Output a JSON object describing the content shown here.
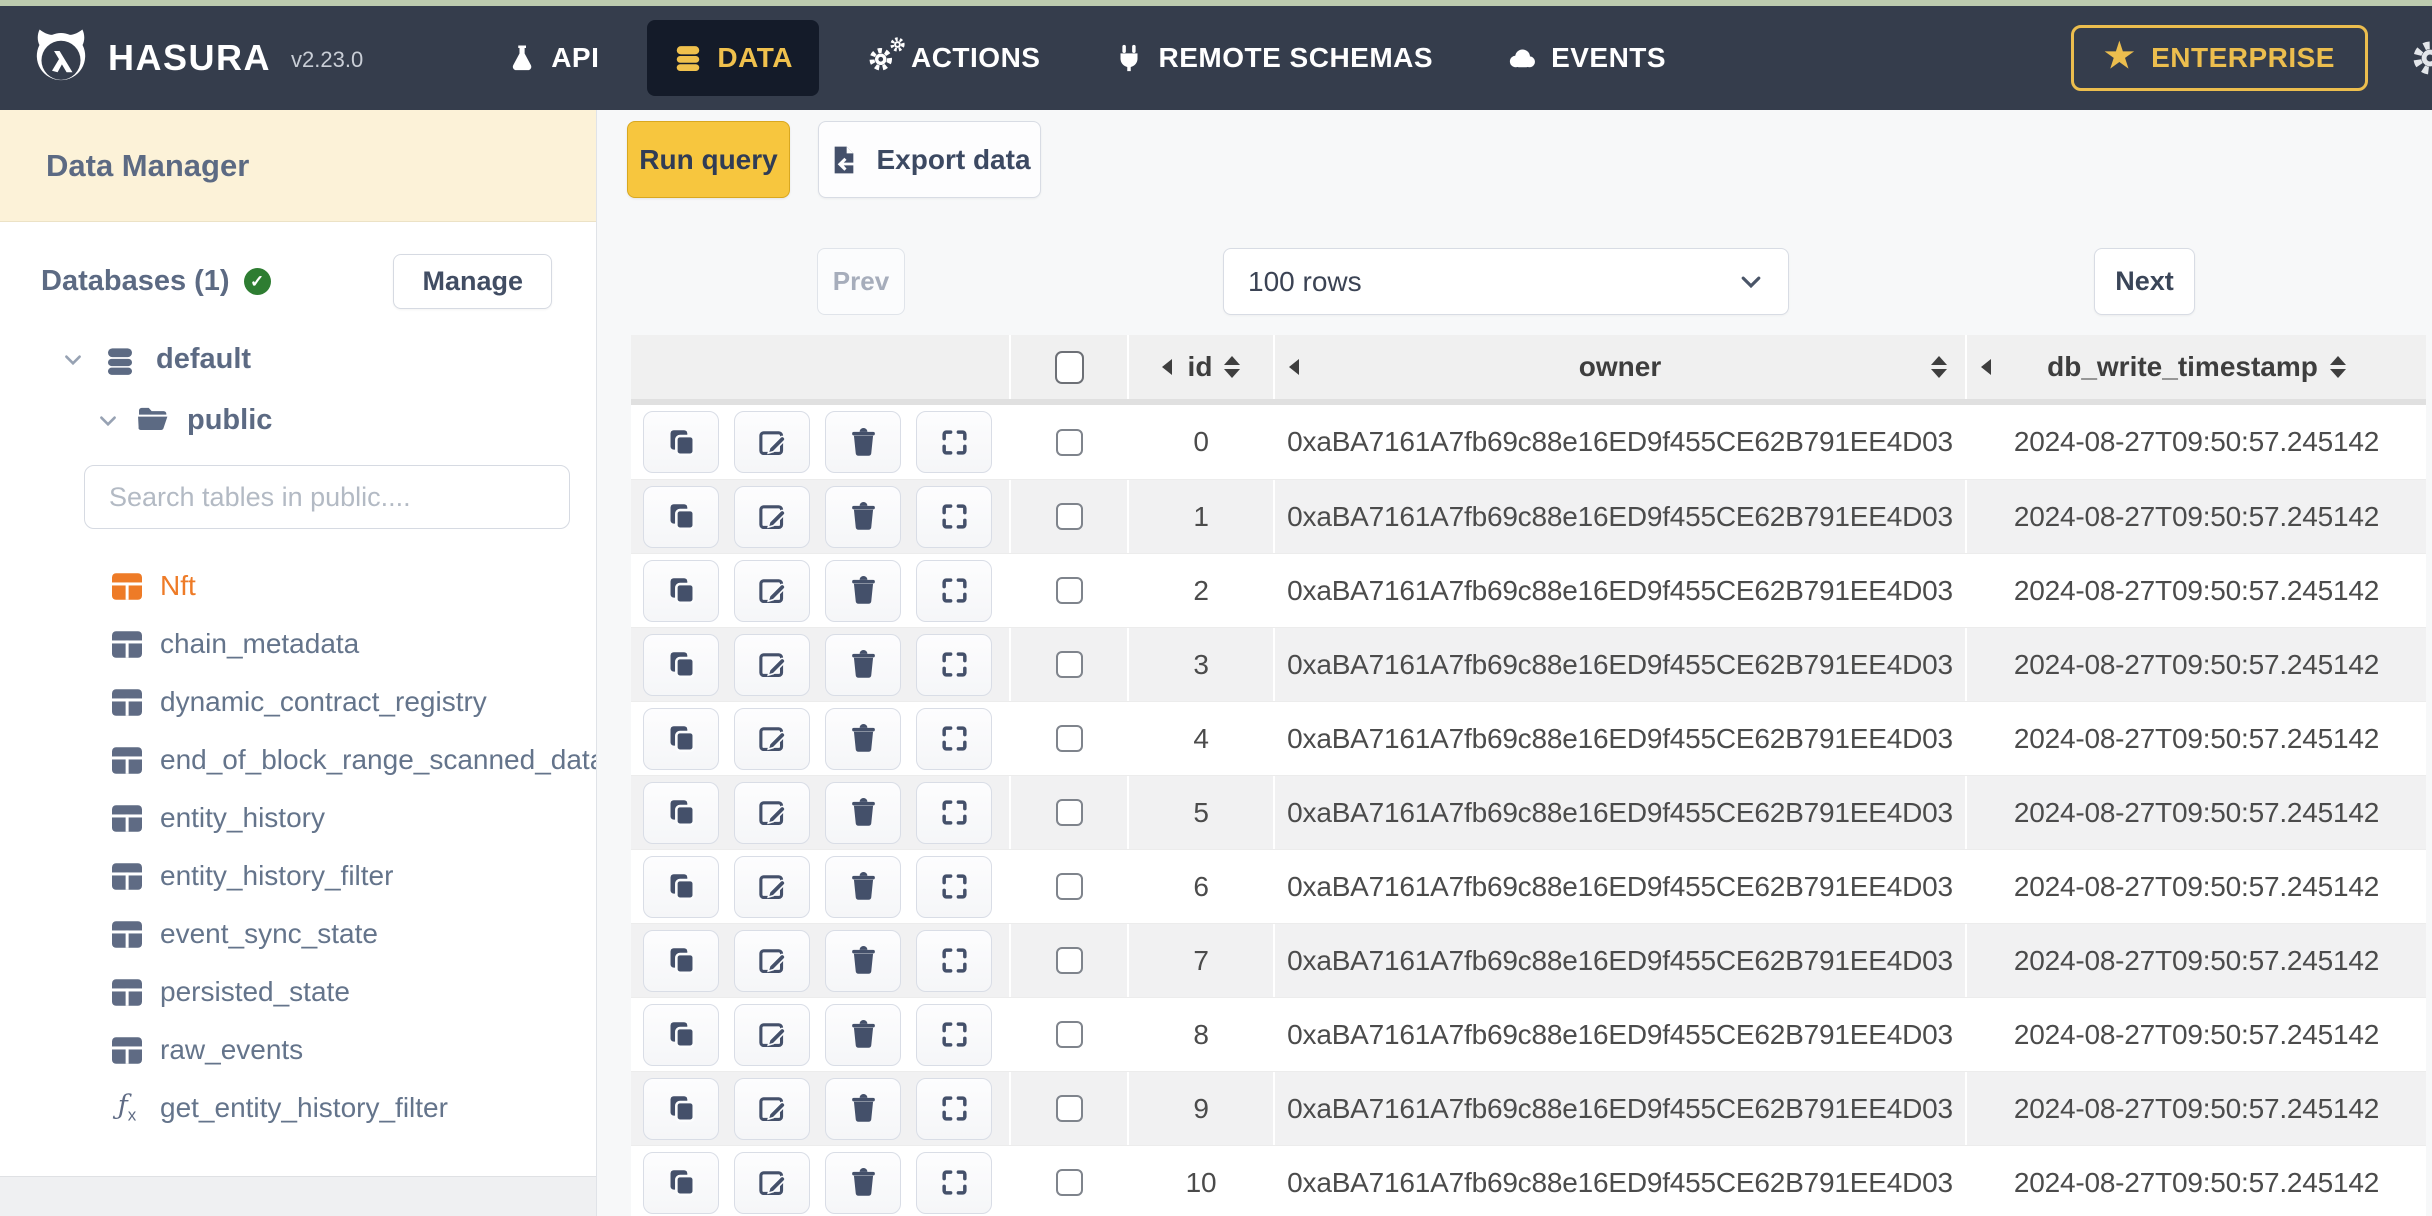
{
  "nav": {
    "brand": "HASURA",
    "version": "v2.23.0",
    "items": [
      {
        "label": "API",
        "icon": "flask-icon"
      },
      {
        "label": "DATA",
        "icon": "database-icon",
        "active": true
      },
      {
        "label": "ACTIONS",
        "icon": "gears-icon"
      },
      {
        "label": "REMOTE SCHEMAS",
        "icon": "plug-icon"
      },
      {
        "label": "EVENTS",
        "icon": "cloud-icon"
      }
    ],
    "enterprise_label": "ENTERPRISE",
    "star_glyph": "★"
  },
  "sidebar": {
    "title": "Data Manager",
    "databases_label": "Databases (1)",
    "check_glyph": "✓",
    "manage_button": "Manage",
    "connection": "default",
    "schema": "public",
    "search_placeholder": "Search tables in public....",
    "tables": [
      {
        "name": "Nft",
        "icon": "table-icon",
        "selected": true
      },
      {
        "name": "chain_metadata",
        "icon": "table-icon"
      },
      {
        "name": "dynamic_contract_registry",
        "icon": "table-icon"
      },
      {
        "name": "end_of_block_range_scanned_data",
        "icon": "table-icon"
      },
      {
        "name": "entity_history",
        "icon": "table-icon"
      },
      {
        "name": "entity_history_filter",
        "icon": "table-icon"
      },
      {
        "name": "event_sync_state",
        "icon": "table-icon"
      },
      {
        "name": "persisted_state",
        "icon": "table-icon"
      },
      {
        "name": "raw_events",
        "icon": "table-icon"
      },
      {
        "name": "get_entity_history_filter",
        "icon": "function-icon"
      }
    ]
  },
  "toolbar": {
    "run_query": "Run query",
    "export_data": "Export data"
  },
  "pagination": {
    "prev": "Prev",
    "rows_select": "100 rows",
    "next": "Next"
  },
  "table": {
    "columns": [
      {
        "key": "id",
        "label": "id"
      },
      {
        "key": "owner",
        "label": "owner"
      },
      {
        "key": "db_write_timestamp",
        "label": "db_write_timestamp"
      }
    ],
    "row_actions": [
      "copy-icon",
      "edit-icon",
      "delete-icon",
      "expand-icon"
    ],
    "rows": [
      {
        "id": "0",
        "owner": "0xaBA7161A7fb69c88e16ED9f455CE62B791EE4D03",
        "db_write_timestamp": "2024-08-27T09:50:57.245142"
      },
      {
        "id": "1",
        "owner": "0xaBA7161A7fb69c88e16ED9f455CE62B791EE4D03",
        "db_write_timestamp": "2024-08-27T09:50:57.245142"
      },
      {
        "id": "2",
        "owner": "0xaBA7161A7fb69c88e16ED9f455CE62B791EE4D03",
        "db_write_timestamp": "2024-08-27T09:50:57.245142"
      },
      {
        "id": "3",
        "owner": "0xaBA7161A7fb69c88e16ED9f455CE62B791EE4D03",
        "db_write_timestamp": "2024-08-27T09:50:57.245142"
      },
      {
        "id": "4",
        "owner": "0xaBA7161A7fb69c88e16ED9f455CE62B791EE4D03",
        "db_write_timestamp": "2024-08-27T09:50:57.245142"
      },
      {
        "id": "5",
        "owner": "0xaBA7161A7fb69c88e16ED9f455CE62B791EE4D03",
        "db_write_timestamp": "2024-08-27T09:50:57.245142"
      },
      {
        "id": "6",
        "owner": "0xaBA7161A7fb69c88e16ED9f455CE62B791EE4D03",
        "db_write_timestamp": "2024-08-27T09:50:57.245142"
      },
      {
        "id": "7",
        "owner": "0xaBA7161A7fb69c88e16ED9f455CE62B791EE4D03",
        "db_write_timestamp": "2024-08-27T09:50:57.245142"
      },
      {
        "id": "8",
        "owner": "0xaBA7161A7fb69c88e16ED9f455CE62B791EE4D03",
        "db_write_timestamp": "2024-08-27T09:50:57.245142"
      },
      {
        "id": "9",
        "owner": "0xaBA7161A7fb69c88e16ED9f455CE62B791EE4D03",
        "db_write_timestamp": "2024-08-27T09:50:57.245142"
      },
      {
        "id": "10",
        "owner": "0xaBA7161A7fb69c88e16ED9f455CE62B791EE4D03",
        "db_write_timestamp": "2024-08-27T09:50:57.245142"
      }
    ]
  },
  "colors": {
    "nav_bg": "#353d4c",
    "nav_active_bg": "#141b29",
    "accent_yellow": "#f0c14d",
    "enterprise_gold": "#ecbe4e",
    "run_query_yellow": "#f7c63e",
    "selected_table_orange": "#ee7b27",
    "slate_text": "#5c6a83",
    "status_green": "#2e7d32",
    "stripe_gray": "#f1f1f2",
    "header_gray": "#f0f0f0",
    "sidebar_header_cream": "#fcf2d8",
    "top_accent_line": "#bccbae"
  }
}
